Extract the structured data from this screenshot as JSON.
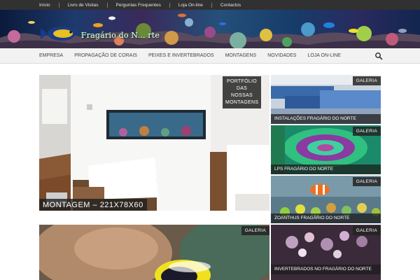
{
  "topnav": {
    "items": [
      "Início",
      "Livro de Visitas",
      "Perguntas Frequentes",
      "Loja On-line",
      "Contactos"
    ]
  },
  "logo": {
    "text": "Fragário do N... rte",
    "icon": "fish-logo-icon"
  },
  "mainnav": {
    "items": [
      "Empresa",
      "Propagação de Corais",
      "Peixes e Invertebrados",
      "Montagens",
      "Novidades",
      "Loja On-line"
    ],
    "search_icon": "search-icon"
  },
  "featured": {
    "badge": "Portfólio das nossas montagens",
    "badge_lines": [
      "Portfólio",
      "das",
      "nossas",
      "montagens"
    ],
    "caption": "MONTAGEM – 221X78X60"
  },
  "side_tiles": [
    {
      "badge": "Galeria",
      "caption": "Instalações Fragário do Norte"
    },
    {
      "badge": "Galeria",
      "caption": "LPS Fragário do Norte"
    },
    {
      "badge": "Galeria",
      "caption": "Zoanthus Fragário do Norte"
    },
    {
      "badge": "Galeria",
      "caption": "Invertebrados no Fragário do Norte"
    }
  ],
  "bottom_feature": {
    "badge": "Galeria"
  },
  "colors": {
    "topbar": "#313131",
    "nav_bg": "#f2f2f2",
    "badge_bg": "#232323"
  }
}
